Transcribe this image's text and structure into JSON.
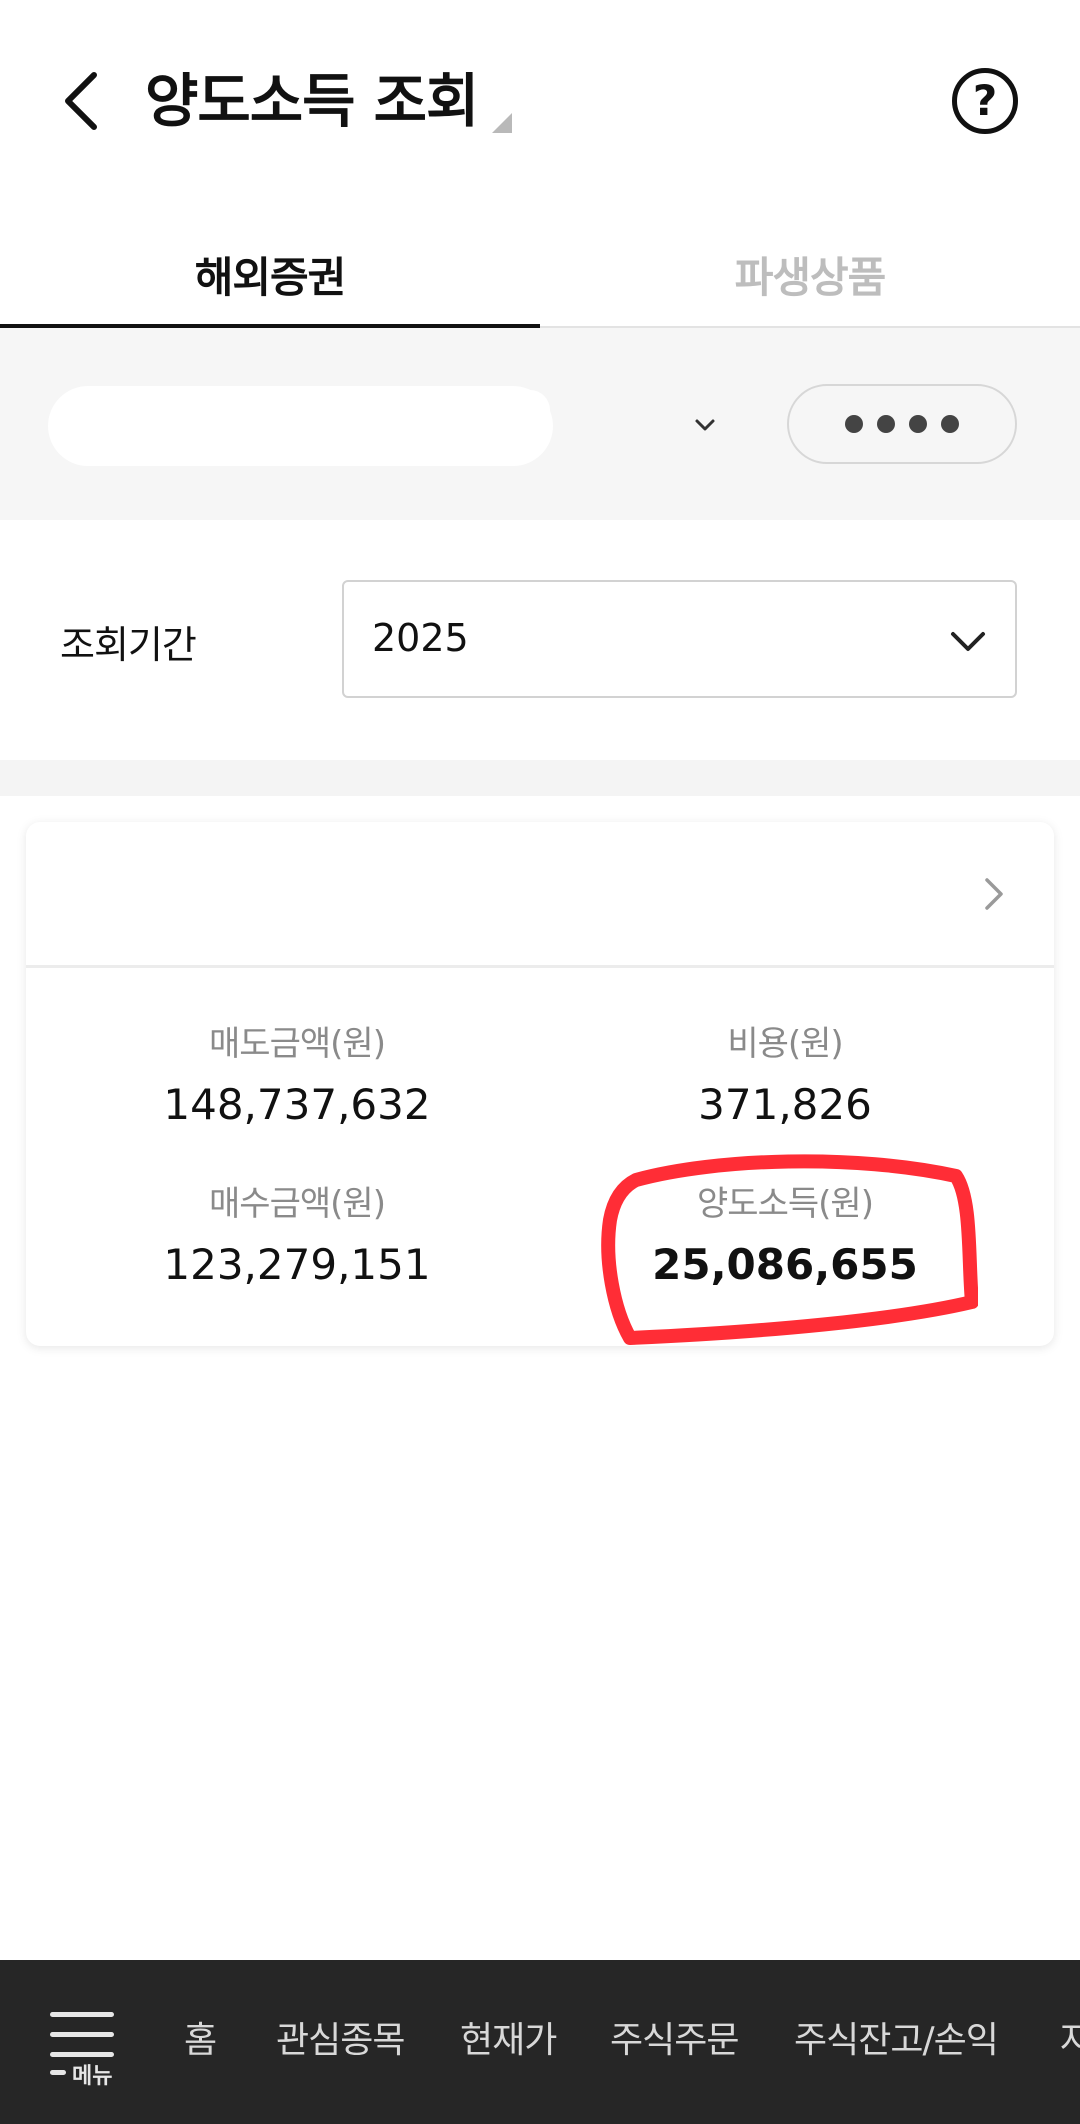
{
  "header": {
    "title": "양도소득 조회",
    "help_label": "?"
  },
  "tabs": [
    {
      "label": "해외증권",
      "active": true
    },
    {
      "label": "파생상품",
      "active": false
    }
  ],
  "account": {
    "pin_dots": 4
  },
  "period": {
    "label": "조회기간",
    "value": "2025"
  },
  "summary": {
    "sell_amount_label": "매도금액(원)",
    "sell_amount": "148,737,632",
    "cost_label": "비용(원)",
    "cost": "371,826",
    "buy_amount_label": "매수금액(원)",
    "buy_amount": "123,279,151",
    "capital_gain_label": "양도소득(원)",
    "capital_gain": "25,086,655"
  },
  "bottom_nav": {
    "menu_label": "메뉴",
    "items": [
      "홈",
      "관심종목",
      "현재가",
      "주식주문",
      "주식잔고/손익",
      "자"
    ]
  },
  "colors": {
    "highlight": "#ff2d36",
    "nav_bg": "#262626"
  }
}
